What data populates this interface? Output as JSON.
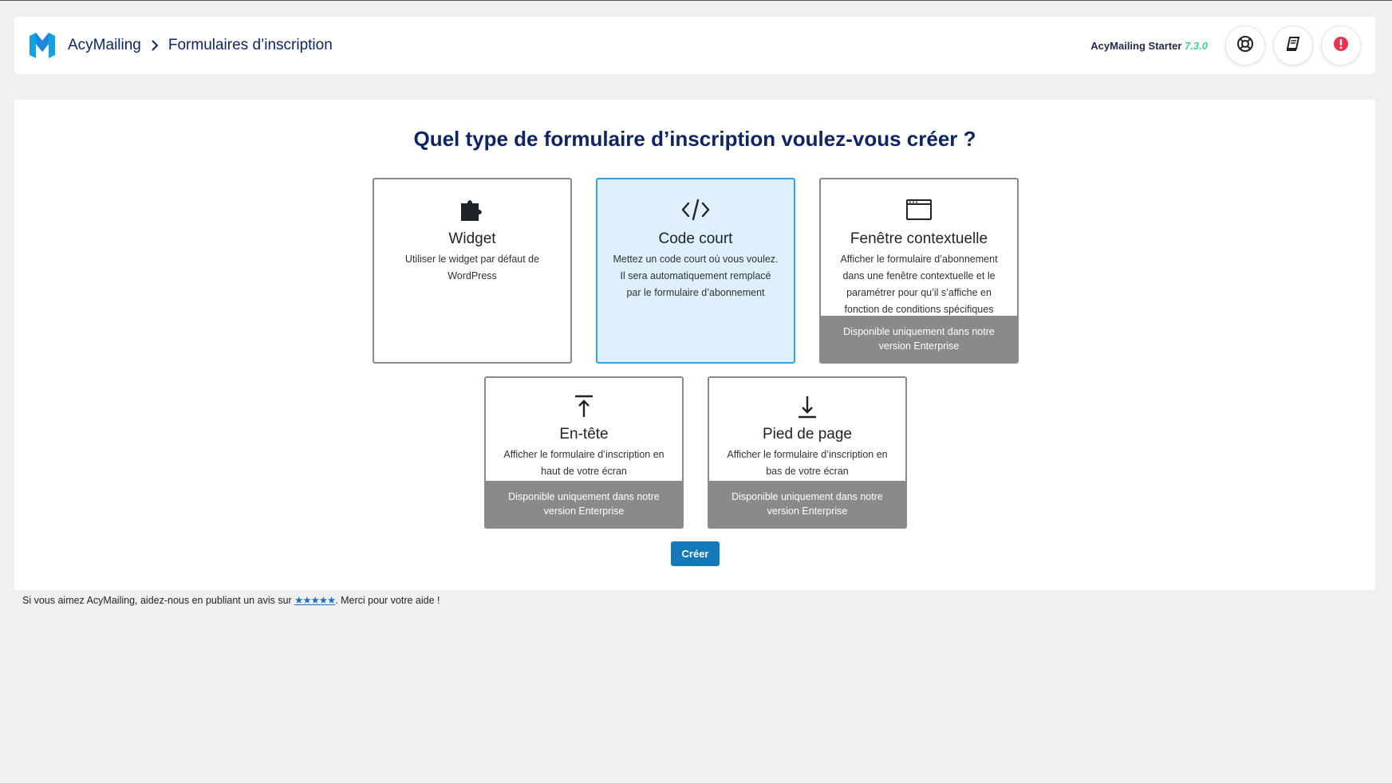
{
  "header": {
    "app_name": "AcyMailing",
    "breadcrumb_sep": "›",
    "page": "Formulaires d’inscription",
    "version_label": "AcyMailing Starter",
    "version_number": "7.3.0",
    "icons": [
      "logo-icon",
      "help-lifebuoy-icon",
      "documentation-book-icon",
      "alert-icon"
    ]
  },
  "main": {
    "title": "Quel type de formulaire d’inscription voulez-vous créer ?",
    "cards": [
      {
        "id": "widget",
        "title": "Widget",
        "desc": "Utiliser le widget par défaut de WordPress",
        "icon": "puzzle-icon",
        "selected": false,
        "locked": ""
      },
      {
        "id": "shortcode",
        "title": "Code court",
        "desc": "Mettez un code court où vous voulez. Il sera automatiquement remplacé par le formulaire d’abonnement",
        "icon": "code-icon",
        "selected": true,
        "locked": ""
      },
      {
        "id": "popup",
        "title": "Fenêtre contextuelle",
        "desc": "Afficher le formulaire d’abonnement dans une fenêtre contextuelle et le paramétrer pour qu’il s’affiche en fonction de conditions spécifiques",
        "icon": "window-icon",
        "selected": false,
        "locked": "Disponible uniquement dans notre version Enterprise"
      },
      {
        "id": "header",
        "title": "En-tête",
        "desc": "Afficher le formulaire d’inscription en haut de votre écran",
        "icon": "arrow-up-to-line-icon",
        "selected": false,
        "locked": "Disponible uniquement dans notre version Enterprise"
      },
      {
        "id": "footer",
        "title": "Pied de page",
        "desc": "Afficher le formulaire d’inscription en bas de votre écran",
        "icon": "arrow-down-to-line-icon",
        "selected": false,
        "locked": "Disponible uniquement dans notre version Enterprise"
      }
    ],
    "create_label": "Créer"
  },
  "footer": {
    "before": "Si vous aimez AcyMailing, aidez-nous en publiant un avis sur ",
    "stars": "★★★★★",
    "after": ". Merci pour votre aide !"
  },
  "colors": {
    "accent": "#1479b8",
    "selected_bg": "#dff0fc",
    "selected_border": "#2ea3f2",
    "title": "#0f2465",
    "locked_bg": "#8a8a8a",
    "version_green": "#3fd28c",
    "alert_red": "#e8344e"
  }
}
